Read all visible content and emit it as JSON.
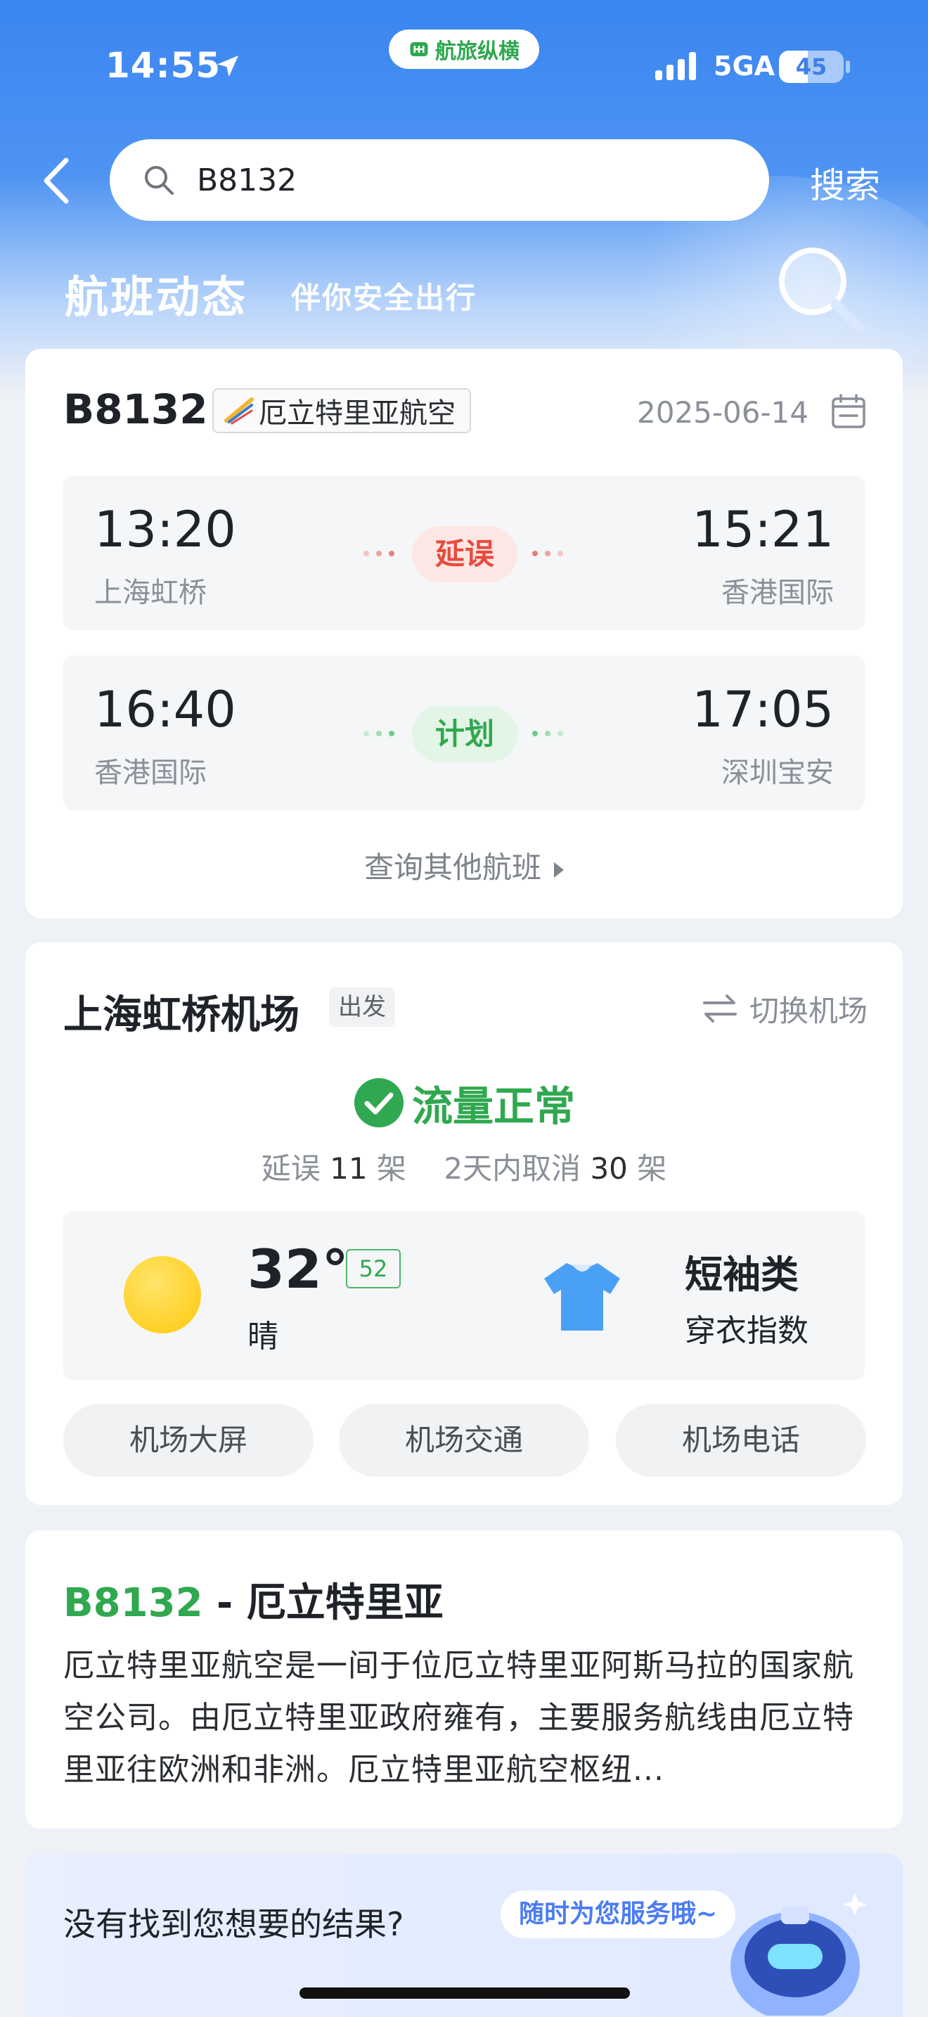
{
  "status_bar": {
    "time": "14:55",
    "app_pill_label": "航旅纵横",
    "network": "5GA",
    "battery": "45",
    "battery_level_percent": 45
  },
  "search": {
    "value": "B8132",
    "button_label": "搜索"
  },
  "header": {
    "title": "航班动态",
    "subtitle": "伴你安全出行"
  },
  "flight_card": {
    "flight_no": "B8132",
    "airline": "厄立特里亚航空",
    "date": "2025-06-14",
    "segments": [
      {
        "dep_time": "13:20",
        "dep_airport": "上海虹桥",
        "status": "延误",
        "arr_time": "15:21",
        "arr_airport": "香港国际"
      },
      {
        "dep_time": "16:40",
        "dep_airport": "香港国际",
        "status": "计划",
        "arr_time": "17:05",
        "arr_airport": "深圳宝安"
      }
    ],
    "more_link": "查询其他航班"
  },
  "airport_card": {
    "name": "上海虹桥机场",
    "badge": "出发",
    "switch_label": "切换机场",
    "flow_status": "流量正常",
    "stats": {
      "delay_prefix": "延误",
      "delay_count": "11",
      "delay_unit": "架",
      "cancel_prefix": "2天内取消",
      "cancel_count": "30",
      "cancel_unit": "架"
    },
    "weather": {
      "temp": "32°",
      "aqi": "52",
      "condition": "晴",
      "clothing_type": "短袖类",
      "clothing_label": "穿衣指数"
    },
    "buttons": [
      "机场大屏",
      "机场交通",
      "机场电话"
    ]
  },
  "airline_info": {
    "flight_no": "B8132",
    "separator": " - ",
    "country": "厄立特里亚",
    "description": "厄立特里亚航空是一间于位厄立特里亚阿斯马拉的国家航空公司。由厄立特里亚政府雍有，主要服务航线由厄立特里亚往欧洲和非洲。厄立特里亚航空枢纽..."
  },
  "bottom_banner": {
    "question": "没有找到您想要的结果?",
    "bubble": "随时为您服务哦~"
  },
  "colors": {
    "header_blue": "#3a85f0",
    "delay_red": "#e84a3d",
    "plan_green": "#2fa84f"
  },
  "icons": [
    "location-arrow-icon",
    "signal-icon",
    "back-icon",
    "search-icon",
    "magnifier-icon",
    "airline-logo-icon",
    "calendar-icon",
    "switch-icon",
    "check-circle-icon",
    "sun-icon",
    "shirt-icon",
    "robot-icon"
  ]
}
